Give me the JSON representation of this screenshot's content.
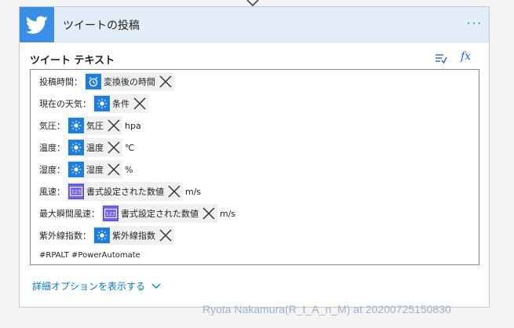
{
  "card": {
    "title": "ツイートの投稿",
    "more_label": "···"
  },
  "field": {
    "label": "ツイート テキスト",
    "fx_label": "fx"
  },
  "tweet_lines": [
    {
      "text": "投稿時間：",
      "token": {
        "label": "変換後の時間",
        "icon": "alarm-clock-icon",
        "color": "#1e7fd8"
      },
      "suffix": ""
    },
    {
      "text": "現在の天気：",
      "token": {
        "label": "条件",
        "icon": "sun-icon",
        "color": "#1e7fd8"
      },
      "suffix": ""
    },
    {
      "text": "気圧：",
      "token": {
        "label": "気圧",
        "icon": "sun-icon",
        "color": "#1e7fd8"
      },
      "suffix": "hpa"
    },
    {
      "text": "温度：",
      "token": {
        "label": "温度",
        "icon": "sun-icon",
        "color": "#1e7fd8"
      },
      "suffix": "℃"
    },
    {
      "text": "湿度：",
      "token": {
        "label": "湿度",
        "icon": "sun-icon",
        "color": "#1e7fd8"
      },
      "suffix": "%"
    },
    {
      "text": "風速：",
      "token": {
        "label": "書式設定された数値",
        "icon": "number-123-icon",
        "color": "#7160e8"
      },
      "suffix": "m/s"
    },
    {
      "text": "最大瞬間風速：",
      "token": {
        "label": "書式設定された数値",
        "icon": "number-123-icon",
        "color": "#7160e8"
      },
      "suffix": "m/s"
    },
    {
      "text": "紫外線指数：",
      "token": {
        "label": "紫外線指数",
        "icon": "sun-icon",
        "color": "#1e7fd8"
      },
      "suffix": ""
    }
  ],
  "hashtags": "#RPALT #PowerAutomate",
  "advanced_options_label": "詳細オプションを表示する",
  "watermark": "Ryota Nakamura(R_t_A_n_M) at 20200725150830"
}
